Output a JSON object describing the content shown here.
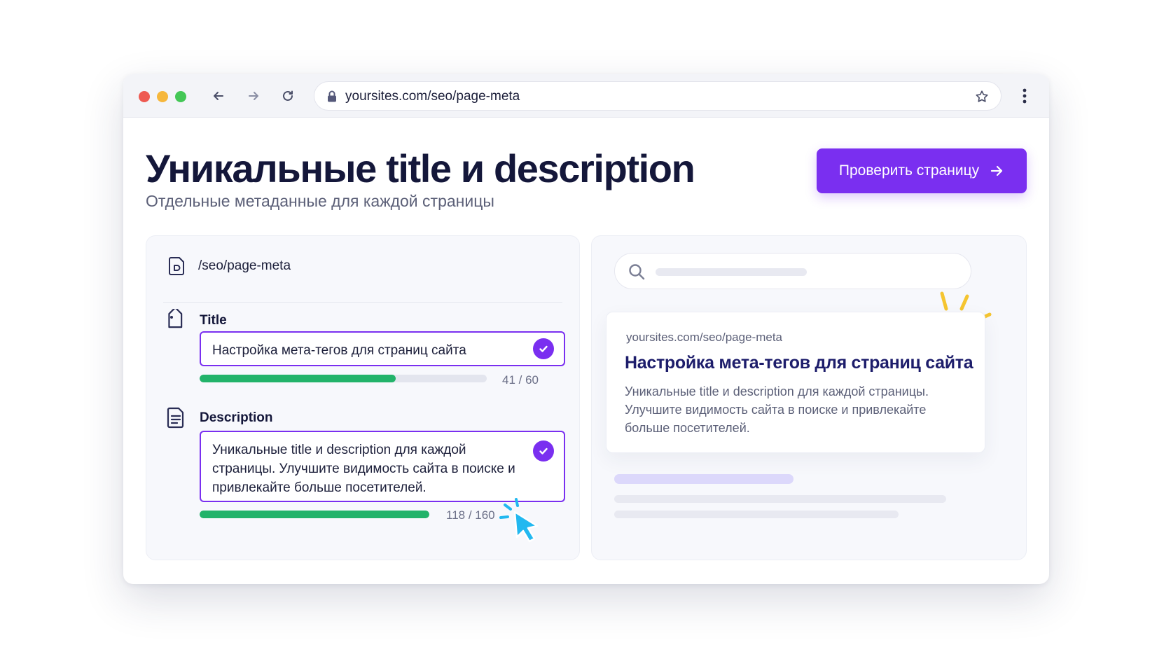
{
  "browser": {
    "url": "yoursites.com/seo/page-meta"
  },
  "page": {
    "title": "Уникальные title и description",
    "subtitle": "Отдельные метаданные для каждой страницы",
    "cta_label": "Проверить страницу"
  },
  "editor": {
    "path": "/seo/page-meta",
    "title_field": {
      "label": "Title",
      "value": "Настройка мета-тегов для страниц сайта",
      "counter": "41 / 60",
      "progress": 0.6833
    },
    "description_field": {
      "label": "Description",
      "value": "Уникальные title и description для каждой страницы. Улучшите видимость сайта в поиске и привлекайте больше посетителей.",
      "counter": "118 / 160",
      "progress": 1.0
    }
  },
  "preview": {
    "url": "yoursites.com/seo/page-meta",
    "title": "Настройка мета-тегов для страниц сайта",
    "description": "Уникальные title и description для каждой страницы. Улучшите видимость сайта в поиске и привлекайте больше посетителей."
  },
  "icons": {
    "back": "arrow-left-icon",
    "forward": "arrow-right-icon",
    "reload": "reload-icon",
    "lock": "lock-icon",
    "bookmark": "star-icon",
    "menu": "kebab-menu-icon",
    "file": "file-icon",
    "tag": "tag-icon",
    "document": "document-icon",
    "check": "check-icon",
    "search": "search-icon",
    "cursor": "cursor-icon"
  },
  "colors": {
    "accent": "#7a2ff0",
    "success": "#22b36a",
    "heading": "#14173a",
    "serp_title": "#1d1d6b",
    "cursor": "#22b8f0",
    "sparkle": "#f5c531"
  }
}
